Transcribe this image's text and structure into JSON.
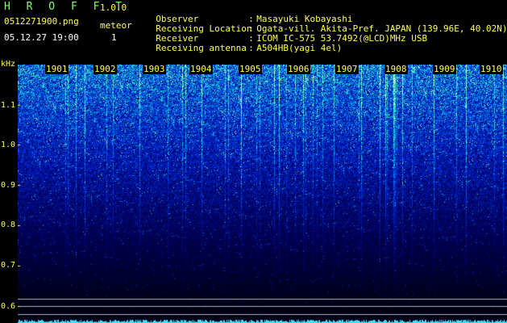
{
  "app": {
    "title": "H R O F F T",
    "version": "1.0.0",
    "filename": "0512271900.png",
    "timestamp": "05.12.27 19:00",
    "meteor_label": "meteor",
    "meteor_count": "1"
  },
  "info": [
    {
      "key": "Observer",
      "sep": ":",
      "value": "Masayuki Kobayashi"
    },
    {
      "key": "Receiving Location",
      "sep": ":",
      "value": "Ogata-vill. Akita-Pref. JAPAN (139.96E, 40.02N)"
    },
    {
      "key": "Receiver",
      "sep": ":",
      "value": "ICOM IC-575 53.7492(@LCD)MHz USB"
    },
    {
      "key": "Receiving antenna",
      "sep": ":",
      "value": "A504HB(yagi 4el)"
    }
  ],
  "axis": {
    "unit": "kHz",
    "y_labels": [
      "1.1",
      "1.0",
      "0.9",
      "0.8",
      "0.7",
      "0.6"
    ],
    "time_labels": [
      "1901",
      "1902",
      "1903",
      "1904",
      "1905",
      "1906",
      "1907",
      "1908",
      "1909",
      "1910"
    ]
  },
  "colors": {
    "header_green": "#7dff6a",
    "header_yellow": "#ffff50",
    "spectrum_low": "#000020",
    "spectrum_mid": "#0030d0",
    "spectrum_high": "#30ffd0"
  }
}
